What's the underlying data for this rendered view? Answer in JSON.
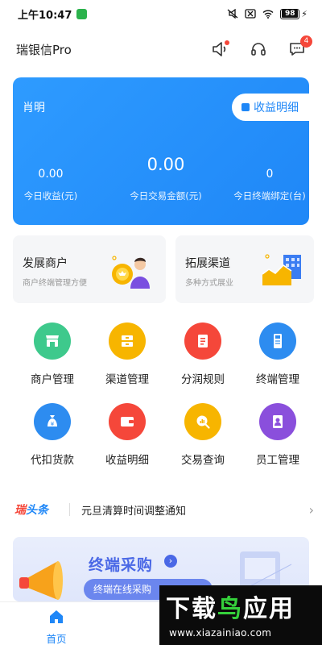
{
  "status_bar": {
    "time": "上午10:47",
    "battery": "98"
  },
  "header": {
    "title": "瑞银信Pro",
    "message_badge": "4"
  },
  "earnings": {
    "name": "肖明",
    "detail_button": "收益明细",
    "stats": [
      {
        "value": "0.00",
        "label": "今日收益(元)"
      },
      {
        "value": "0.00",
        "label": "今日交易金额(元)"
      },
      {
        "value": "0",
        "label": "今日终端绑定(台)"
      }
    ]
  },
  "features": [
    {
      "title": "发展商户",
      "subtitle": "商户终端管理方便"
    },
    {
      "title": "拓展渠道",
      "subtitle": "多种方式展业"
    }
  ],
  "grid": [
    {
      "label": "商户管理",
      "icon": "merchant-icon",
      "color": "#3ec98c"
    },
    {
      "label": "渠道管理",
      "icon": "channel-icon",
      "color": "#f7b500"
    },
    {
      "label": "分润规则",
      "icon": "profit-rule-icon",
      "color": "#f5473a"
    },
    {
      "label": "终端管理",
      "icon": "terminal-icon",
      "color": "#2d8cf0"
    },
    {
      "label": "代扣货款",
      "icon": "deduct-icon",
      "color": "#2d8cf0"
    },
    {
      "label": "收益明细",
      "icon": "wallet-icon",
      "color": "#f5473a"
    },
    {
      "label": "交易查询",
      "icon": "chart-query-icon",
      "color": "#f7b500"
    },
    {
      "label": "员工管理",
      "icon": "staff-icon",
      "color": "#8a4fdc"
    }
  ],
  "news": {
    "brand_prefix": "瑞",
    "brand_suffix": "头条",
    "text": "元旦清算时间调整通知"
  },
  "banner": {
    "title": "终端采购",
    "pill": "终端在线采购"
  },
  "bottom_nav": {
    "home_label": "首页"
  },
  "watermark": {
    "brand_a": "下载",
    "brand_b": "鸟",
    "brand_c": "应用",
    "url": "www.xiazainiao.com"
  },
  "colors": {
    "primary": "#1f87f7",
    "accent_red": "#f5473a",
    "watermark_green": "#35d13b"
  }
}
